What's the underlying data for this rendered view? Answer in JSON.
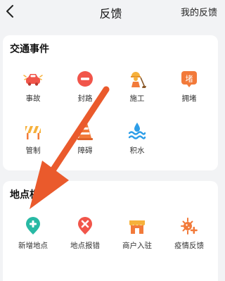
{
  "header": {
    "title": "反馈",
    "my_feedback_label": "我的反馈"
  },
  "traffic": {
    "title": "交通事件",
    "items": [
      {
        "label": "事故",
        "icon": "car-crash-icon"
      },
      {
        "label": "封路",
        "icon": "road-closed-icon"
      },
      {
        "label": "施工",
        "icon": "construction-worker-icon"
      },
      {
        "label": "拥堵",
        "icon": "congestion-icon"
      },
      {
        "label": "管制",
        "icon": "traffic-control-barrier-icon"
      },
      {
        "label": "障碍",
        "icon": "obstacle-cone-icon"
      },
      {
        "label": "积水",
        "icon": "waterlogging-icon"
      }
    ]
  },
  "location": {
    "title": "地点相",
    "items": [
      {
        "label": "新增地点",
        "icon": "add-place-icon"
      },
      {
        "label": "地点报错",
        "icon": "place-error-icon"
      },
      {
        "label": "商户入驻",
        "icon": "merchant-shop-icon"
      },
      {
        "label": "疫情反馈",
        "icon": "epidemic-virus-icon"
      }
    ]
  },
  "colors": {
    "accent_orange": "#f27a3a",
    "red": "#f1554a",
    "green": "#28b9a4",
    "yellow": "#f6b13b",
    "blue": "#2d9ee8",
    "arrow": "#ea5a2c"
  }
}
